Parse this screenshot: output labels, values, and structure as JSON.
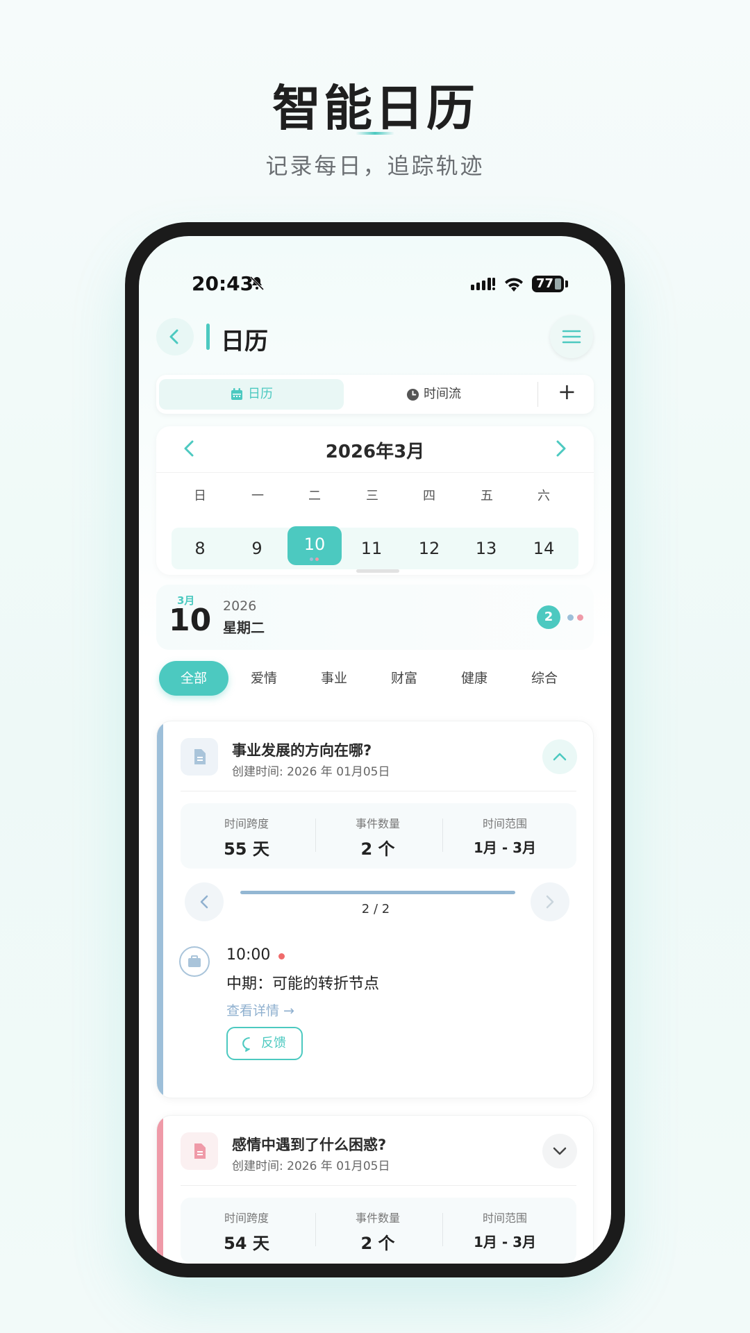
{
  "hero": {
    "title": "智能日历",
    "subtitle": "记录每日，追踪轨迹"
  },
  "status_bar": {
    "time": "20:43",
    "battery": "77"
  },
  "header": {
    "title": "日历"
  },
  "segments": {
    "calendar": "日历",
    "timeline": "时间流",
    "add": "+"
  },
  "calendar": {
    "month_title": "2026年3月",
    "weekdays": [
      "日",
      "一",
      "二",
      "三",
      "四",
      "五",
      "六"
    ],
    "days": [
      "8",
      "9",
      "10",
      "11",
      "12",
      "13",
      "14"
    ],
    "selected_day": "10"
  },
  "date_card": {
    "month": "3月",
    "day": "10",
    "year": "2026",
    "weekday": "星期二",
    "event_count": "2"
  },
  "chips": [
    "全部",
    "爱情",
    "事业",
    "财富",
    "健康",
    "综合"
  ],
  "cards": [
    {
      "title": "事业发展的方向在哪?",
      "created": "创建时间: 2026 年 01月05日",
      "stats": [
        {
          "label": "时间跨度",
          "value": "55 天"
        },
        {
          "label": "事件数量",
          "value": "2 个"
        },
        {
          "label": "时间范围",
          "value": "1月 - 3月"
        }
      ],
      "pager": "2 / 2",
      "progress": 1.0,
      "event": {
        "time": "10:00",
        "title": "中期：可能的转折节点",
        "link": "查看详情 →",
        "feedback": "反馈"
      },
      "color": "#9dbfd9"
    },
    {
      "title": "感情中遇到了什么困惑?",
      "created": "创建时间: 2026 年 01月05日",
      "stats": [
        {
          "label": "时间跨度",
          "value": "54 天"
        },
        {
          "label": "事件数量",
          "value": "2 个"
        },
        {
          "label": "时间范围",
          "value": "1月 - 3月"
        }
      ],
      "color": "#ef9aa8"
    }
  ],
  "colors": {
    "accent": "#4cc9c0",
    "career": "#9dbfd9",
    "love": "#ef9aa8",
    "event_dot": "#ef6b6b"
  }
}
